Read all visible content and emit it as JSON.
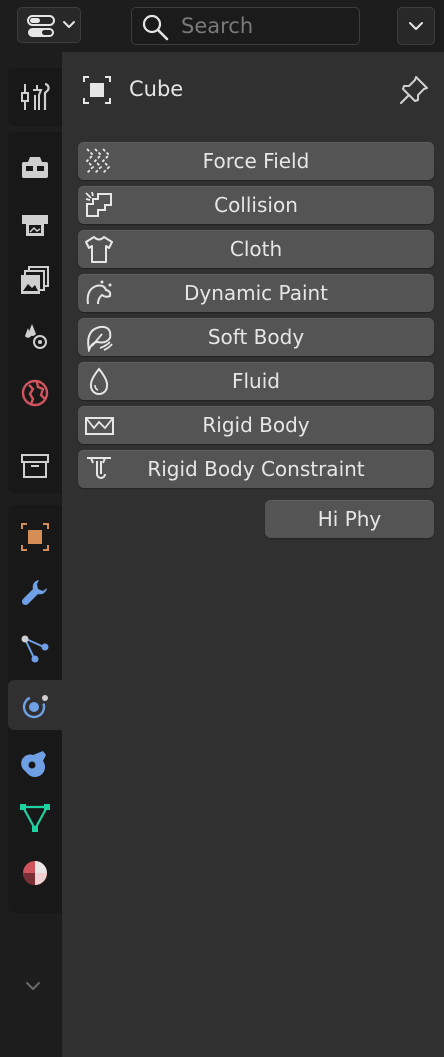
{
  "header": {
    "editor_type_icon": "properties-editor-icon",
    "search_placeholder": "Search",
    "options_icon": "chevron-down-icon"
  },
  "tabs": [
    {
      "name": "tool",
      "icon": "tool-icon"
    },
    {
      "name": "render",
      "icon": "render-icon"
    },
    {
      "name": "output",
      "icon": "output-icon"
    },
    {
      "name": "view-layer",
      "icon": "view-layer-icon"
    },
    {
      "name": "scene",
      "icon": "scene-icon"
    },
    {
      "name": "world",
      "icon": "world-icon"
    },
    {
      "name": "collection",
      "icon": "collection-icon"
    },
    {
      "name": "object",
      "icon": "object-icon"
    },
    {
      "name": "modifiers",
      "icon": "modifier-wrench-icon"
    },
    {
      "name": "particles",
      "icon": "particles-icon"
    },
    {
      "name": "physics",
      "icon": "physics-icon",
      "active": true
    },
    {
      "name": "constraints",
      "icon": "object-constraint-icon"
    },
    {
      "name": "data",
      "icon": "mesh-data-icon"
    },
    {
      "name": "material",
      "icon": "material-icon"
    }
  ],
  "object": {
    "name": "Cube",
    "pin_icon": "pin-icon"
  },
  "physics_buttons": [
    {
      "label": "Force Field",
      "icon": "force-field-icon"
    },
    {
      "label": "Collision",
      "icon": "collision-icon"
    },
    {
      "label": "Cloth",
      "icon": "cloth-icon"
    },
    {
      "label": "Dynamic Paint",
      "icon": "dynamic-paint-icon"
    },
    {
      "label": "Soft Body",
      "icon": "soft-body-icon"
    },
    {
      "label": "Fluid",
      "icon": "fluid-icon"
    },
    {
      "label": "Rigid Body",
      "icon": "rigid-body-icon"
    },
    {
      "label": "Rigid Body Constraint",
      "icon": "rigid-body-constraint-icon"
    }
  ],
  "extra_button": {
    "label": "Hi Phy"
  },
  "colors": {
    "background": "#303030",
    "header": "#1d1d1d",
    "button": "#545454",
    "object_orange": "#d48e56",
    "modifier_blue": "#6f9fe5",
    "physics_blue": "#6f9fe5",
    "data_green": "#1fd1a0",
    "world_red": "#d0545d",
    "material_red": "#d0545d"
  }
}
